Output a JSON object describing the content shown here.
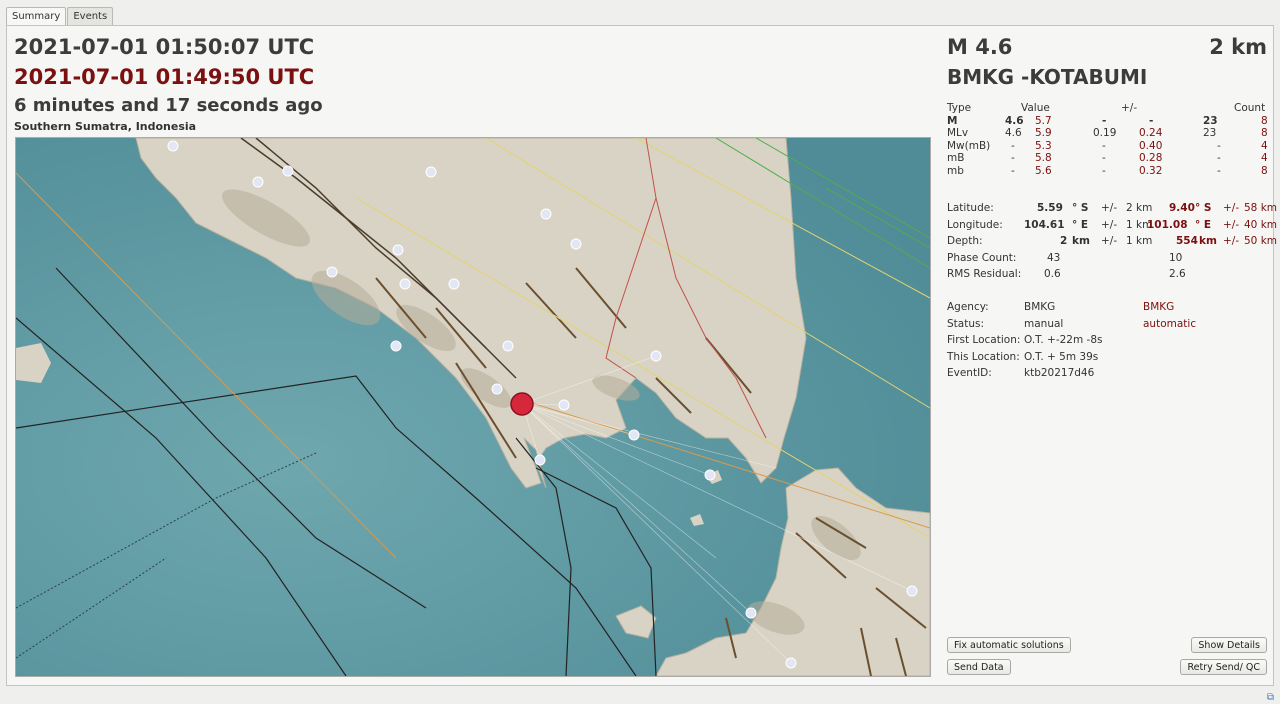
{
  "tabs": [
    "Summary",
    "Events"
  ],
  "header": {
    "time_utc": "2021-07-01 01:50:07 UTC",
    "origin_utc": "2021-07-01 01:49:50 UTC",
    "elapsed": "6 minutes and 17 seconds ago",
    "region": "Southern Sumatra, Indonesia"
  },
  "summary": {
    "magnitude": "M 4.6",
    "depth": "2 km",
    "agency_title": "BMKG -KOTABUMI"
  },
  "mag_table": {
    "headers": {
      "type": "Type",
      "value": "Value",
      "uncert": "+/-",
      "count": "Count"
    },
    "rows": [
      {
        "type": "M",
        "v1": "4.6",
        "v2": "5.7",
        "u1": "-",
        "u2": "-",
        "n1": "23",
        "n2": "8"
      },
      {
        "type": "MLv",
        "v1": "4.6",
        "v2": "5.9",
        "u1": "0.19",
        "u2": "0.24",
        "n1": "23",
        "n2": "8"
      },
      {
        "type": "Mw(mB)",
        "v1": "-",
        "v2": "5.3",
        "u1": "-",
        "u2": "0.40",
        "n1": "-",
        "n2": "4"
      },
      {
        "type": "mB",
        "v1": "-",
        "v2": "5.8",
        "u1": "-",
        "u2": "0.28",
        "n1": "-",
        "n2": "4"
      },
      {
        "type": "mb",
        "v1": "-",
        "v2": "5.6",
        "u1": "-",
        "u2": "0.32",
        "n1": "-",
        "n2": "8"
      }
    ]
  },
  "location": {
    "latitude": {
      "label": "Latitude:",
      "v1": "5.59",
      "unit": "° S",
      "pm": "+/-",
      "u1": "2 km",
      "v2": "9.40",
      "u2": "58 km"
    },
    "longitude": {
      "label": "Longitude:",
      "v1": "104.61",
      "unit": "° E",
      "pm": "+/-",
      "u1": "1 km",
      "v2": "101.08",
      "u2": "40 km"
    },
    "depth": {
      "label": "Depth:",
      "v1": "2",
      "unit": "km",
      "pm": "+/-",
      "u1": "1 km",
      "v2": "554",
      "u2": "50 km"
    },
    "phase_count": {
      "label": "Phase Count:",
      "v1": "43",
      "v2": "10"
    },
    "rms": {
      "label": "RMS Residual:",
      "v1": "0.6",
      "v2": "2.6"
    }
  },
  "info": {
    "agency": {
      "label": "Agency:",
      "v1": "BMKG",
      "v2": "BMKG"
    },
    "status": {
      "label": "Status:",
      "v1": "manual",
      "v2": "automatic"
    },
    "first_location": {
      "label": "First Location:",
      "v1": "O.T. +-22m -8s"
    },
    "this_location": {
      "label": "This Location:",
      "v1": "O.T. + 5m 39s"
    },
    "event_id": {
      "label": "EventID:",
      "v1": "ktb20217d46"
    }
  },
  "buttons": {
    "fix": "Fix automatic solutions",
    "show_details": "Show Details",
    "send_data": "Send Data",
    "retry": "Retry Send/ QC"
  },
  "colors": {
    "accent_red": "#7a1010",
    "epicenter": "#d6283a",
    "sea": "#5f9aa3",
    "land": "#d9d4c6"
  }
}
